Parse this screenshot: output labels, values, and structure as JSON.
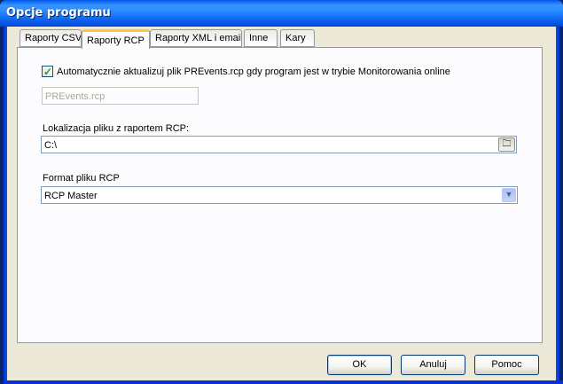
{
  "window": {
    "title": "Opcje programu"
  },
  "tabs": [
    {
      "label": "Raporty CSV",
      "active": false
    },
    {
      "label": "Raporty RCP",
      "active": true
    },
    {
      "label": "Raporty XML i email",
      "active": false
    },
    {
      "label": "Inne",
      "active": false
    },
    {
      "label": "Kary",
      "active": false
    }
  ],
  "rcp_page": {
    "auto_update": {
      "label": "Automatycznie aktualizuj plik PREvents.rcp gdy program jest w trybie Monitorowania online",
      "checked": true
    },
    "events_file": {
      "value": "PREvents.rcp",
      "disabled": true
    },
    "report_location": {
      "label": "Lokalizacja pliku z raportem RCP:",
      "value": "C:\\",
      "browse_icon": "folder-browse-icon"
    },
    "file_format": {
      "label": "Format pliku RCP",
      "selected": "RCP Master",
      "arrow_icon": "chevron-down-icon"
    }
  },
  "buttons": {
    "ok": "OK",
    "cancel": "Anuluj",
    "help": "Pomoc"
  },
  "colors": {
    "titlebar": "#0a5ded",
    "accent_tab": "#ffc83c",
    "check": "#21a121",
    "face": "#ece9d8"
  }
}
